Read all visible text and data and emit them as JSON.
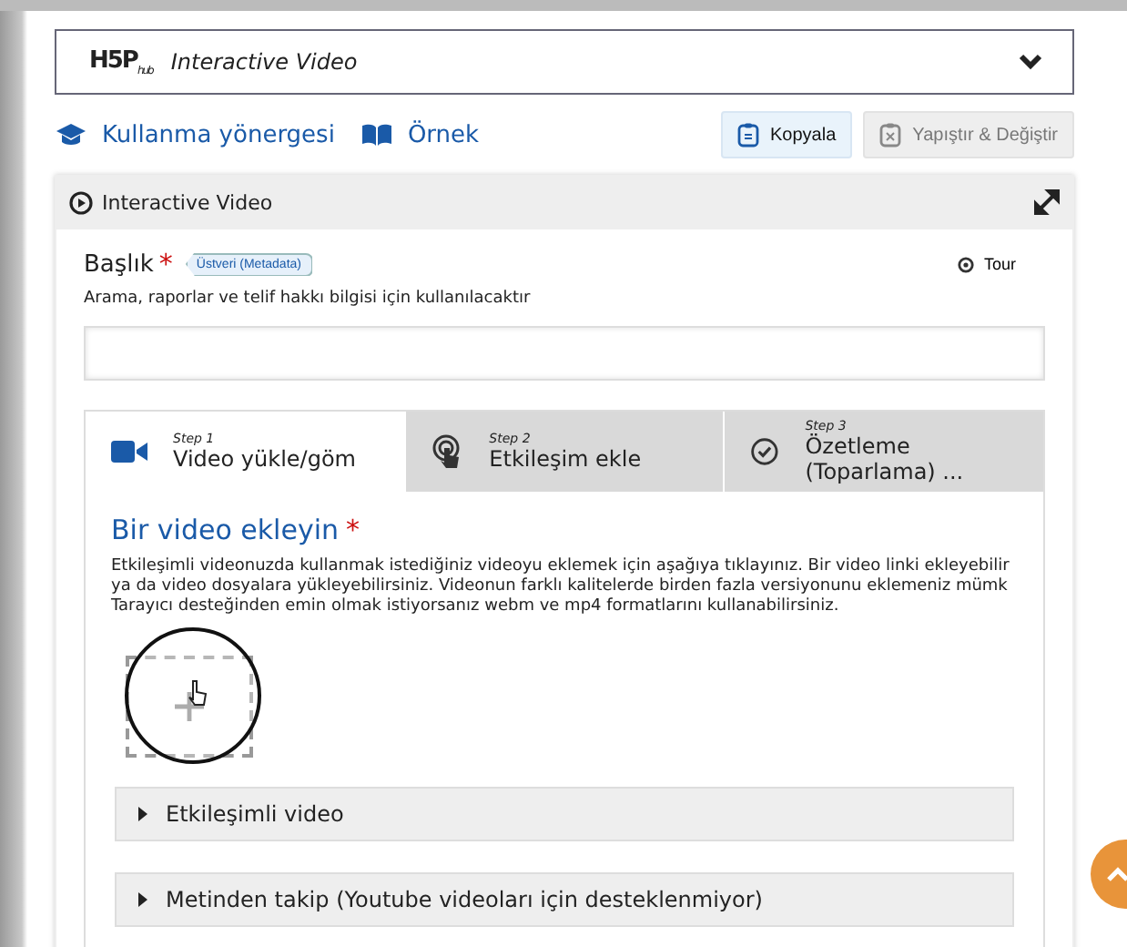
{
  "header": {
    "logo": "H5P",
    "logo_sub": "hub",
    "title": "Interactive Video"
  },
  "links": [
    {
      "label": "Kullanma yönergesi",
      "kind": "tutorial"
    },
    {
      "label": "Örnek",
      "kind": "example"
    }
  ],
  "actions": [
    {
      "label": "Kopyala",
      "disabled": false,
      "kind": "copy"
    },
    {
      "label": "Yapıştır & Değiştir",
      "disabled": true,
      "kind": "paste"
    }
  ],
  "editor": {
    "title": "Interactive Video",
    "field": {
      "label": "Başlık",
      "required": "*",
      "metadata": "Üstveri (Metadata)",
      "tour": "Tour",
      "description": "Arama, raporlar ve telif hakkı bilgisi için kullanılacaktır"
    },
    "steps": [
      {
        "step": "Step 1",
        "label": "Video yükle/göm",
        "selected": true,
        "kind": "video"
      },
      {
        "step": "Step 2",
        "label": "Etkileşim ekle",
        "selected": false,
        "kind": "touch"
      },
      {
        "step": "Step 3",
        "label": "Özetleme (Toparlama) ...",
        "selected": false,
        "kind": "check"
      }
    ],
    "section": {
      "title": "Bir video ekleyin",
      "required": "*",
      "description": "Etkileşimli videonuzda kullanmak istediğiniz videoyu eklemek için aşağıya tıklayınız. Bir video linki ekleyebilir ya da video dosyalara yükleyebilirsiniz. Videonun farklı kalitelerde birden fazla versiyonunu eklemeniz mümk Tarayıcı desteğinden emin olmak istiyorsanız webm ve mp4 formatlarını kullanabilirsiniz."
    },
    "groups": [
      {
        "label": "Etkileşimli video",
        "expanded": false
      },
      {
        "label": "Metinden takip (Youtube videoları için desteklenmiyor)",
        "expanded": false
      }
    ]
  }
}
